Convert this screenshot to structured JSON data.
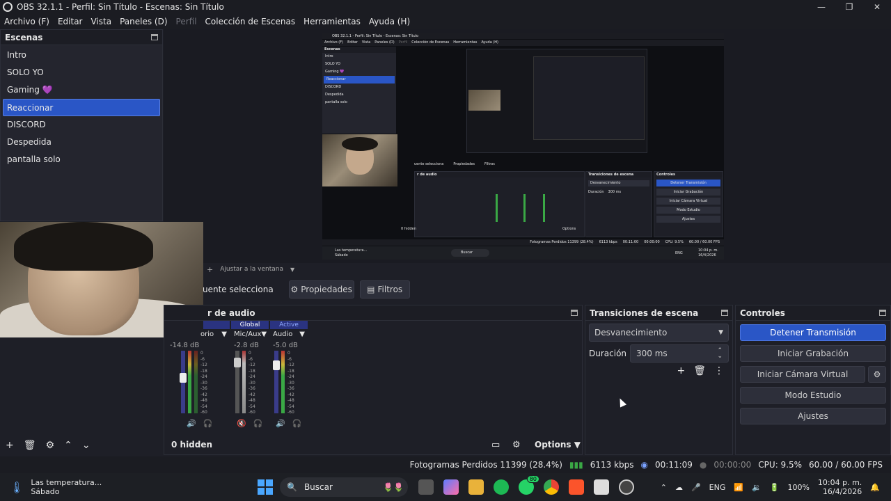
{
  "window": {
    "title": "OBS 32.1.1 - Perfil: Sin Título - Escenas: Sin Título"
  },
  "menu": [
    "Archivo (F)",
    "Editar",
    "Vista",
    "Paneles (D)",
    "Perfil",
    "Colección de Escenas",
    "Herramientas",
    "Ayuda (H)"
  ],
  "scenes": {
    "title": "Escenas",
    "items": [
      {
        "label": "Intro"
      },
      {
        "label": "SOLO YO"
      },
      {
        "label": "Gaming 💜"
      },
      {
        "label": "Reaccionar"
      },
      {
        "label": "DISCORD"
      },
      {
        "label": "Despedida"
      },
      {
        "label": "pantalla solo"
      }
    ],
    "selected": "Reaccionar"
  },
  "nested_preview": {
    "title": "OBS 32.1.1 - Perfil: Sin Título - Escenas: Sin Título",
    "menu": [
      "Archivo (F)",
      "Editar",
      "Vista",
      "Paneles (D)",
      "Perfil",
      "Colección de Escenas",
      "Herramientas",
      "Ayuda (H)"
    ],
    "scenes": [
      "Intro",
      "SOLO YO",
      "Gaming 💜",
      "Reaccionar",
      "DISCORD",
      "Despedida",
      "pantalla solo"
    ],
    "source_label": "uente selecciona",
    "props": "Propiedades",
    "filters": "Filtros",
    "mixer_title": "r de audio",
    "transitions_title": "Transiciones de escena",
    "controls_title": "Controles",
    "trans_select": "Desvanecimiento",
    "duration_label": "Duración",
    "duration_value": "300 ms",
    "controls": [
      "Detener Transmisión",
      "Iniciar Grabación",
      "Iniciar Cámara Virtual",
      "Modo Estudio",
      "Ajustes"
    ],
    "hidden": "0 hidden",
    "options": "Options",
    "status": "Fotogramas Perdidos 11399 (28.4%)",
    "kbps": "6113 kbps",
    "time": "00:11:00",
    "rec": "00:00:00",
    "cpu": "CPU: 9.5%",
    "fps": "60.00 / 60.00 FPS",
    "taskbar_weather": "Las temperatura...",
    "taskbar_day": "Sábado",
    "taskbar_search": "Buscar",
    "taskbar_lang": "ENG",
    "taskbar_time": "10:04 p. m.",
    "taskbar_date": "16/4/2026"
  },
  "preview_bar": {
    "fit": "Ajustar a la ventana"
  },
  "source_bar": {
    "label": "uente selecciona",
    "props": "Propiedades",
    "filters": "Filtros"
  },
  "mixer": {
    "title": "r de audio",
    "channels": [
      {
        "header": "",
        "name": "orio",
        "db": "-14.8 dB",
        "level": 0.45
      },
      {
        "header": "Global",
        "name": "Mic/Aux",
        "db": "-2.8 dB",
        "level": 0.15
      },
      {
        "header": "Active",
        "name": "Audio",
        "db": "-5.0 dB",
        "level": 0.25
      }
    ],
    "ticks": [
      "0",
      "-6",
      "-12",
      "-18",
      "-24",
      "-30",
      "-36",
      "-42",
      "-48",
      "-54",
      "-60"
    ],
    "hidden": "0 hidden",
    "options": "Options"
  },
  "transitions": {
    "title": "Transiciones de escena",
    "select": "Desvanecimiento",
    "duration_label": "Duración",
    "duration_value": "300 ms"
  },
  "controls": {
    "title": "Controles",
    "stream": "Detener Transmisión",
    "record": "Iniciar Grabación",
    "vcam": "Iniciar Cámara Virtual",
    "studio": "Modo Estudio",
    "settings": "Ajustes",
    "accent": "#2a56c6"
  },
  "status": {
    "dropped": "Fotogramas Perdidos 11399 (28.4%)",
    "kbps": "6113 kbps",
    "live_time": "00:11:09",
    "rec_time": "00:00:00",
    "cpu": "CPU: 9.5%",
    "fps": "60.00 / 60.00 FPS"
  },
  "taskbar": {
    "weather_title": "Las temperatura...",
    "weather_day": "Sábado",
    "search": "Buscar",
    "whatsapp_badge": "80",
    "lang": "ENG",
    "battery": "100%",
    "time": "10:04 p. m.",
    "date": "16/4/2026"
  }
}
